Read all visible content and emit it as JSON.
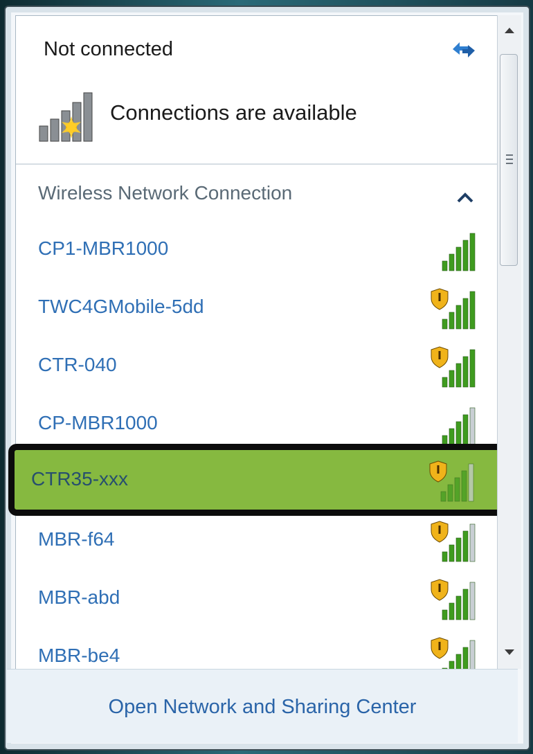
{
  "status": {
    "title": "Not connected",
    "subtitle": "Connections are available",
    "icon": "network-status-icon"
  },
  "section": {
    "title": "Wireless Network Connection",
    "collapse_icon": "chevron-up-icon"
  },
  "networks": [
    {
      "name": "CP1-MBR1000",
      "signal_bars": 5,
      "secured": false
    },
    {
      "name": "TWC4GMobile-5dd",
      "signal_bars": 5,
      "secured": true
    },
    {
      "name": "CTR-040",
      "signal_bars": 5,
      "secured": true
    },
    {
      "name": "CP-MBR1000",
      "signal_bars": 4,
      "secured": false
    },
    {
      "name": "CTR35-xxx",
      "signal_bars": 4,
      "secured": true,
      "highlighted": true
    },
    {
      "name": "MBR-f64",
      "signal_bars": 4,
      "secured": true
    },
    {
      "name": "MBR-abd",
      "signal_bars": 4,
      "secured": true
    },
    {
      "name": "MBR-be4",
      "signal_bars": 4,
      "secured": true
    }
  ],
  "footer": {
    "link": "Open Network and Sharing Center"
  },
  "colors": {
    "link": "#2f6fb5",
    "highlight": "#86b940",
    "signal": "#3f9b1f"
  }
}
